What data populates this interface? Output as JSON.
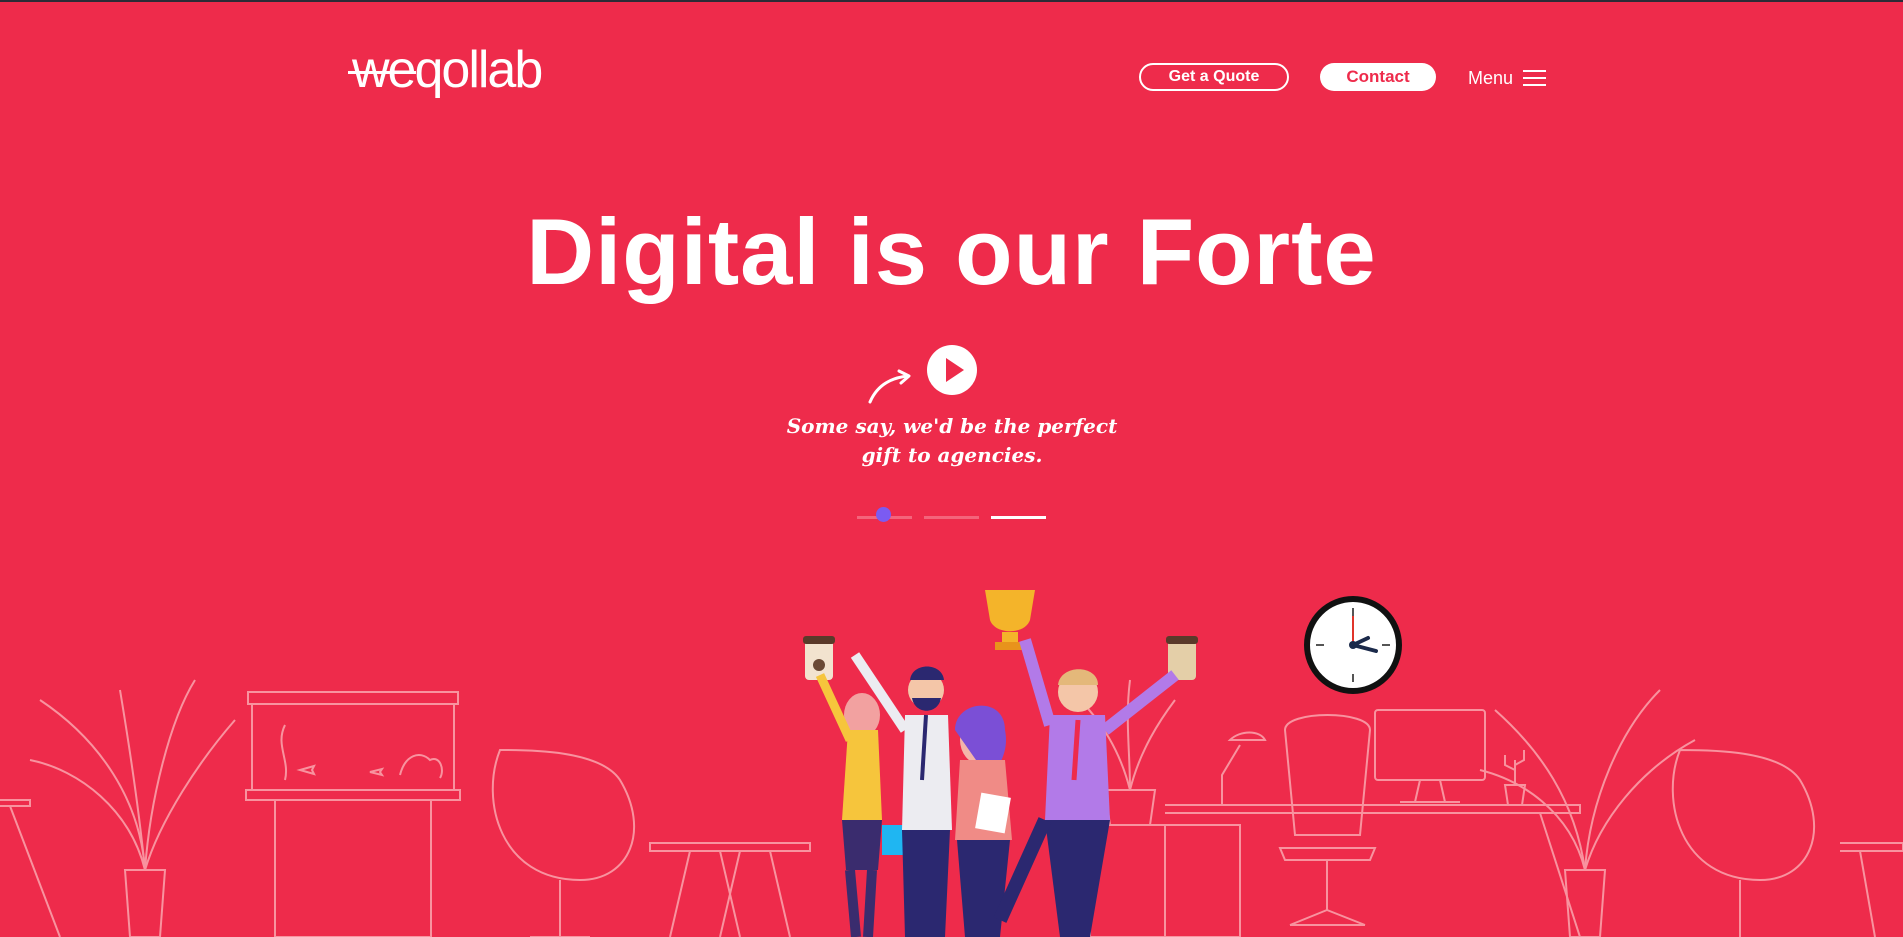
{
  "brand": {
    "logo_text_we": "we",
    "logo_text_rest": "qollab"
  },
  "nav": {
    "quote_label": "Get a Quote",
    "contact_label": "Contact",
    "menu_label": "Menu"
  },
  "hero": {
    "headline": "Digital is our Forte",
    "tagline_line1": "Some say, we'd be the perfect",
    "tagline_line2": "gift to agencies."
  },
  "slider": {
    "slide_count": 3,
    "active_index": 3
  },
  "colors": {
    "background": "#ee2b4b",
    "accent": "#7b5bf2",
    "line_art": "#f8939f"
  },
  "icons": [
    "play-icon",
    "curved-arrow-icon",
    "hamburger-icon",
    "clock-icon",
    "trophy-icon",
    "coffee-cup-icon"
  ]
}
